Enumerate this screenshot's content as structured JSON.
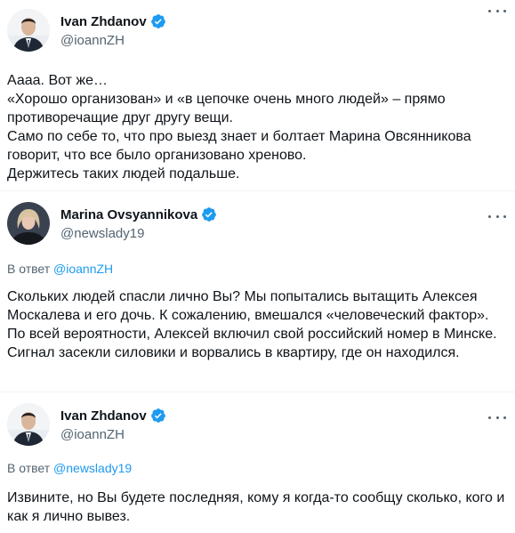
{
  "tweets": [
    {
      "author": {
        "name": "Ivan Zhdanov",
        "handle": "@ioannZH",
        "verified": true,
        "avatar": "man-in-suit-avatar"
      },
      "lines": [
        "Аааа. Вот же…",
        "«Хорошо организован» и «в цепочке очень много людей» – прямо противоречащие друг другу вещи.",
        "Само по себе то, что про выезд знает и болтает Марина Овсянникова говорит, что все было организовано хреново.",
        "Держитесь таких людей подальше."
      ]
    },
    {
      "author": {
        "name": "Marina Ovsyannikova",
        "handle": "@newslady19",
        "verified": true,
        "avatar": "woman-blonde-avatar"
      },
      "reply_prefix": "В ответ",
      "reply_to": "@ioannZH",
      "text": "Скольких людей спасли лично Вы? Мы попытались вытащить Алексея Москалева и его дочь. К сожалению, вмешался «человеческий фактор». По всей вероятности, Алексей включил свой российский номер в Минске. Сигнал засекли силовики и ворвались в квартиру, где он находился."
    },
    {
      "author": {
        "name": "Ivan Zhdanov",
        "handle": "@ioannZH",
        "verified": true,
        "avatar": "man-in-suit-avatar"
      },
      "reply_prefix": "В ответ",
      "reply_to": "@newslady19",
      "text": "Извините, но Вы будете последняя, кому я когда-то сообщу сколько, кого и как я лично вывез."
    }
  ],
  "colors": {
    "text": "#0f1419",
    "secondary": "#536471",
    "link": "#1d9bf0",
    "verified": "#1d9bf0"
  }
}
